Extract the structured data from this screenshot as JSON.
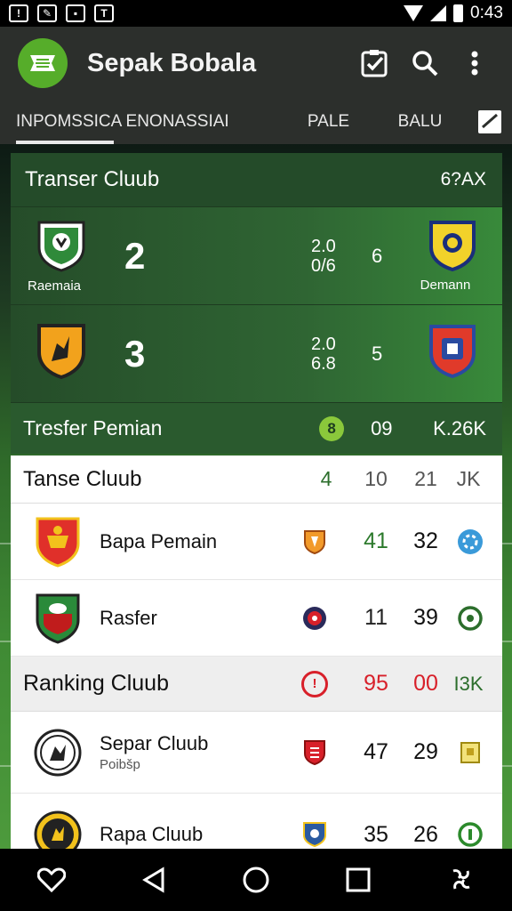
{
  "status_bar": {
    "time": "0:43",
    "left_icons": [
      "warning-icon",
      "edit-icon",
      "notification-icon",
      "shirt-icon"
    ]
  },
  "app_bar": {
    "title": "Sepak Bobala",
    "logo_icon": "football-logo-icon",
    "actions": [
      "checklist-icon",
      "search-icon",
      "more-vert-icon"
    ]
  },
  "tabs": {
    "items": [
      "INPOMSSICA ENONASSIAI",
      "PALE",
      "BALU"
    ],
    "active_index": 0,
    "extra_icon": "calendar-icon"
  },
  "transfer_panel": {
    "title": "Transer Cluub",
    "header_value": "6?AX",
    "matches": [
      {
        "home_name": "Raemaia",
        "home_score": "2",
        "mid_top": "2.0",
        "mid_bottom": "0/6",
        "mid_right": "6",
        "away_name": "Demann"
      },
      {
        "home_name": "",
        "home_score": "3",
        "mid_top": "2.0",
        "mid_bottom": "6.8",
        "mid_right": "5",
        "away_name": ""
      }
    ],
    "footer": {
      "title": "Tresfer Pemian",
      "mini_badge": "8",
      "value1": "09",
      "value2": "K.26K"
    }
  },
  "club_list": {
    "header": {
      "title": "Tanse Cluub",
      "c1": "4",
      "c2": "10",
      "c3": "21",
      "c4": "JK"
    },
    "rows": [
      {
        "name": "Bapa Pemain",
        "sub": "",
        "v1": "41",
        "v2": "32",
        "v1_color": "#2c7a2c"
      },
      {
        "name": "Rasfer",
        "sub": "",
        "v1": "11",
        "v2": "39",
        "v1_color": "#111111"
      }
    ],
    "ranking": {
      "title": "Ranking Cluub",
      "v1": "95",
      "v2": "00",
      "v3": "I3K"
    },
    "ranking_rows": [
      {
        "name": "Separ Cluub",
        "sub": "Poibšp",
        "v1": "47",
        "v2": "29"
      },
      {
        "name": "Rapa Cluub",
        "sub": "",
        "v1": "35",
        "v2": "26"
      }
    ]
  },
  "nav_bar": [
    "heart-icon",
    "back-icon",
    "home-icon",
    "recents-icon",
    "share-icon"
  ],
  "colors": {
    "accent_green": "#56ad2a",
    "app_bar": "#2c2f2c",
    "ranking_red": "#d8202a"
  }
}
